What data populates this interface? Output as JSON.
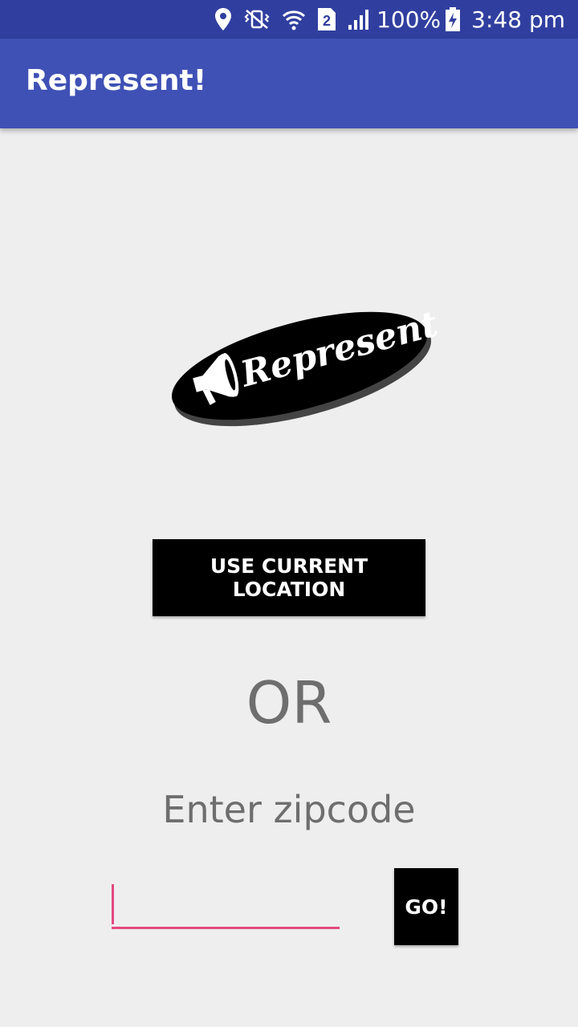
{
  "status_bar": {
    "icons": [
      "location-icon",
      "vibrate-icon",
      "wifi-icon",
      "sim2-icon",
      "signal-icon",
      "battery-charging-icon"
    ],
    "sim_label": "2",
    "battery": "100%",
    "time": "3:48 pm"
  },
  "app_bar": {
    "title": "Represent!"
  },
  "logo": {
    "text": "Represent!",
    "icon": "megaphone-icon"
  },
  "main": {
    "location_button_label": "USE CURRENT LOCATION",
    "or_text": "OR",
    "zip_label": "Enter zipcode",
    "zip_value": "",
    "go_button_label": "GO!"
  },
  "colors": {
    "status_bar": "#303f9f",
    "app_bar": "#3f51b5",
    "background": "#eeeeee",
    "accent": "#e4487f",
    "button": "#000000"
  }
}
